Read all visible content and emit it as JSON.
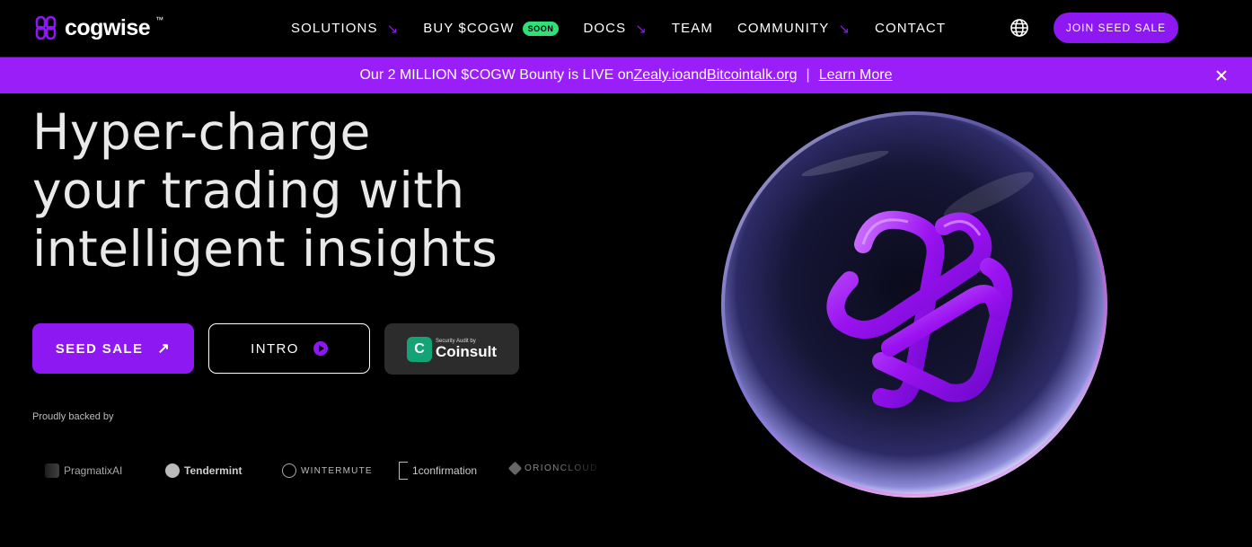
{
  "nav": {
    "logo_text": "cogwise",
    "logo_tm": "™",
    "items": [
      {
        "label": "SOLUTIONS",
        "arrow": "↘"
      },
      {
        "label": "BUY $COGW",
        "badge": "SOON"
      },
      {
        "label": "DOCS",
        "arrow": "↘"
      },
      {
        "label": "TEAM"
      },
      {
        "label": "COMMUNITY",
        "arrow": "↘"
      },
      {
        "label": "CONTACT"
      }
    ],
    "language_icon": "globe-icon",
    "join_label": "JOIN SEED SALE"
  },
  "banner": {
    "text_before": "Our 2 MILLION $COGW Bounty is LIVE on ",
    "link1": "Zealy.io ",
    "and": " and ",
    "link2": "Bitcointalk.org ",
    "separator": "|",
    "learn_more": "Learn More",
    "close_icon": "close-icon"
  },
  "hero": {
    "headline": [
      "Hyper-charge",
      "your trading with",
      "intelligent insights"
    ],
    "seed_label": "SEED SALE",
    "seed_arrow": "↗",
    "intro_label": "INTRO",
    "audit_small": "Security Audit by",
    "audit_brand": "Coinsult",
    "backed_label": "Proudly backed by",
    "partners": [
      "PragmatixAI",
      "Tendermint",
      "WINTERMUTE",
      "1confirmation",
      "ORIONCLOUD"
    ]
  },
  "colors": {
    "accent": "#8d18f2",
    "banner": "#9a1ef7",
    "soon_badge": "#2ee07a",
    "audit_green": "#13a374",
    "background": "#000000"
  }
}
